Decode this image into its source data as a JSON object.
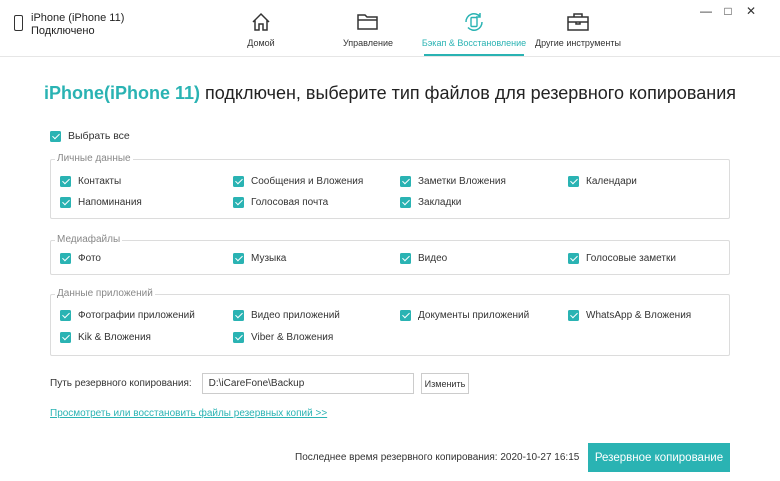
{
  "device": {
    "name": "iPhone (iPhone 11)",
    "status": "Подключено"
  },
  "nav": [
    {
      "label": "Домой",
      "icon": "home-icon"
    },
    {
      "label": "Управление",
      "icon": "folder-icon"
    },
    {
      "label": "Бэкап & Восстановление",
      "icon": "backup-restore-icon",
      "active": true
    },
    {
      "label": "Другие инструменты",
      "icon": "toolbox-icon"
    }
  ],
  "window_controls": {
    "minimize": "—",
    "maximize": "□",
    "close": "✕"
  },
  "headline": {
    "device": "iPhone(iPhone 11)",
    "text": " подключен, выберите тип файлов для резервного копирования"
  },
  "select_all": "Выбрать все",
  "groups": [
    {
      "title": "Личные данные",
      "items": [
        "Контакты",
        "Сообщения и Вложения",
        "Заметки Вложения",
        "Календари",
        "Напоминания",
        "Голосовая почта",
        "Закладки"
      ]
    },
    {
      "title": "Медиафайлы",
      "items": [
        "Фото",
        "Музыка",
        "Видео",
        "Голосовые заметки"
      ]
    },
    {
      "title": "Данные приложений",
      "items": [
        "Фотографии приложений",
        "Видео приложений",
        "Документы приложений",
        "WhatsApp & Вложения",
        "Kik & Вложения",
        "Viber & Вложения"
      ]
    }
  ],
  "backup_path": {
    "label": "Путь резервного копирования:",
    "value": "D:\\iCareFone\\Backup",
    "change_button": "Изменить"
  },
  "view_link": "Просмотреть или восстановить файлы резервных копий >>",
  "last_backup": "Последнее время резервного копирования: 2020-10-27 16:15",
  "backup_button": "Резервное копирование",
  "accent_color": "#2ab3b3"
}
